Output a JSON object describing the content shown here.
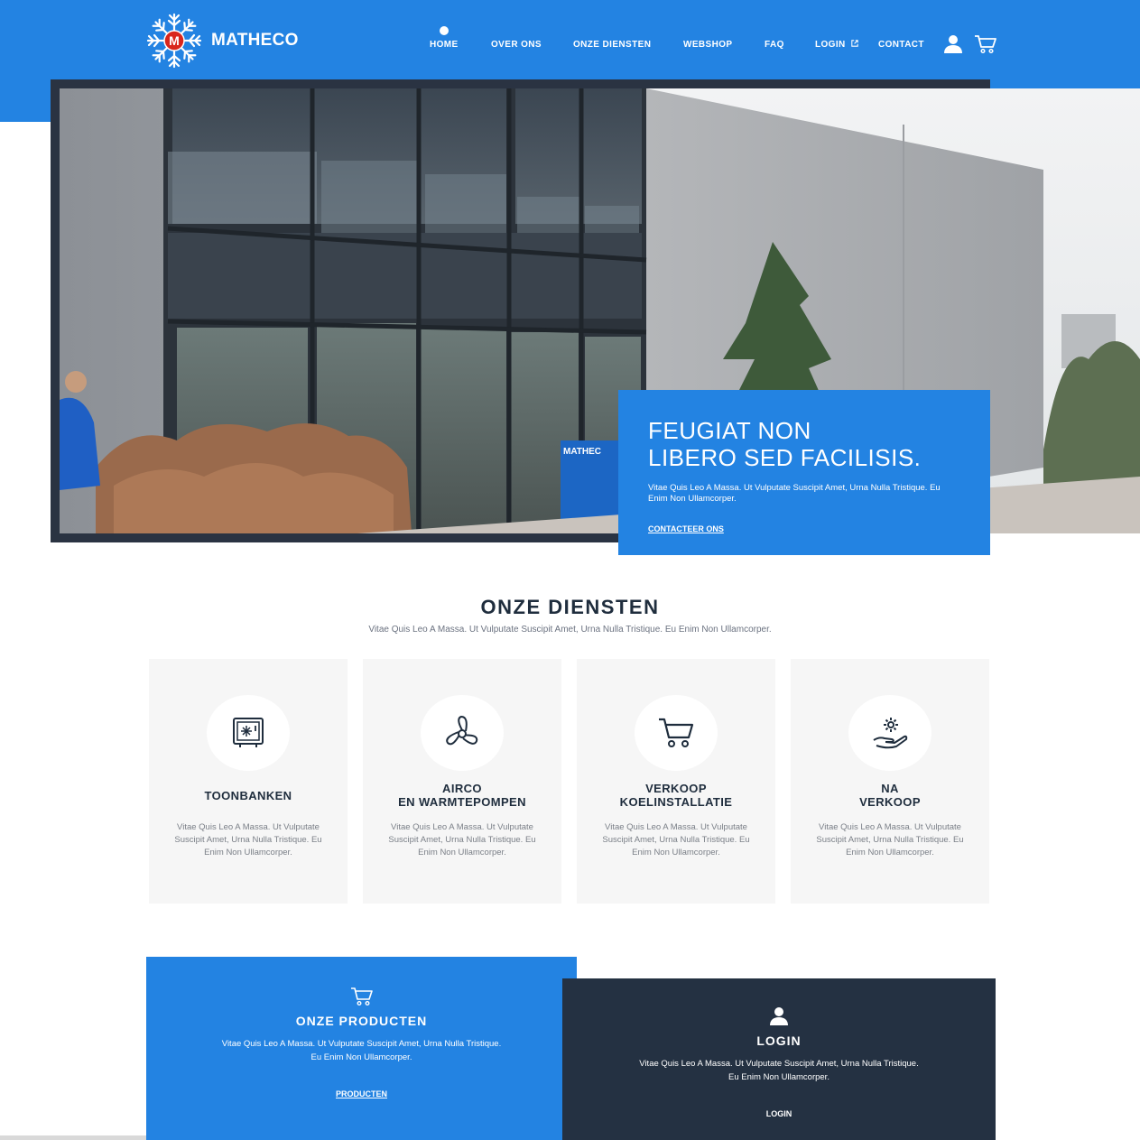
{
  "header": {
    "brand": "MATHECO",
    "logo_letter": "M",
    "nav": [
      {
        "label": "HOME",
        "active": true
      },
      {
        "label": "OVER ONS"
      },
      {
        "label": "ONZE DIENSTEN"
      },
      {
        "label": "WEBSHOP"
      },
      {
        "label": "FAQ"
      },
      {
        "label": "LOGIN",
        "external": true
      },
      {
        "label": "CONTACT"
      }
    ],
    "icons": [
      "user-icon",
      "cart-icon"
    ]
  },
  "hero": {
    "title": "FEUGIAT NON\nLIBERO SED FACILISIS.",
    "text": "Vitae Quis Leo A Massa. Ut Vulputate Suscipit Amet, Urna Nulla Tristique. Eu Enim Non Ullamcorper.",
    "link": "CONTACTEER ONS",
    "window_sign": "MATHEC"
  },
  "services": {
    "title": "ONZE DIENSTEN",
    "subtitle": "Vitae Quis Leo A Massa. Ut Vulputate Suscipit Amet, Urna Nulla Tristique. Eu Enim Non Ullamcorper.",
    "cards": [
      {
        "icon": "freezer-icon",
        "title": "TOONBANKEN",
        "text": "Vitae Quis Leo A Massa. Ut Vulputate Suscipit Amet, Urna Nulla Tristique. Eu Enim Non Ullamcorper."
      },
      {
        "icon": "fan-icon",
        "title": "AIRCO\nEN WARMTEPOMPEN",
        "text": "Vitae Quis Leo A Massa. Ut Vulputate Suscipit Amet, Urna Nulla Tristique. Eu Enim Non Ullamcorper."
      },
      {
        "icon": "cart-icon",
        "title": "VERKOOP\nKOELINSTALLATIE",
        "text": "Vitae Quis Leo A Massa. Ut Vulputate Suscipit Amet, Urna Nulla Tristique. Eu Enim Non Ullamcorper."
      },
      {
        "icon": "gear-hand-icon",
        "title": "NA\nVERKOOP",
        "text": "Vitae Quis Leo A Massa. Ut Vulputate Suscipit Amet, Urna Nulla Tristique. Eu Enim Non Ullamcorper."
      }
    ]
  },
  "panels": {
    "products": {
      "icon": "cart-icon",
      "title": "ONZE PRODUCTEN",
      "text": "Vitae Quis Leo A Massa. Ut Vulputate Suscipit Amet, Urna Nulla Tristique. Eu Enim Non Ullamcorper.",
      "link": "PRODUCTEN"
    },
    "login": {
      "icon": "user-icon",
      "title": "LOGIN",
      "text": "Vitae Quis Leo A Massa. Ut Vulputate Suscipit Amet, Urna Nulla Tristique. Eu Enim Non Ullamcorper.",
      "link": "LOGIN"
    }
  },
  "colors": {
    "primary": "#2383e2",
    "dark": "#243142",
    "card_bg": "#f6f6f6",
    "logo_red": "#d9261c"
  }
}
